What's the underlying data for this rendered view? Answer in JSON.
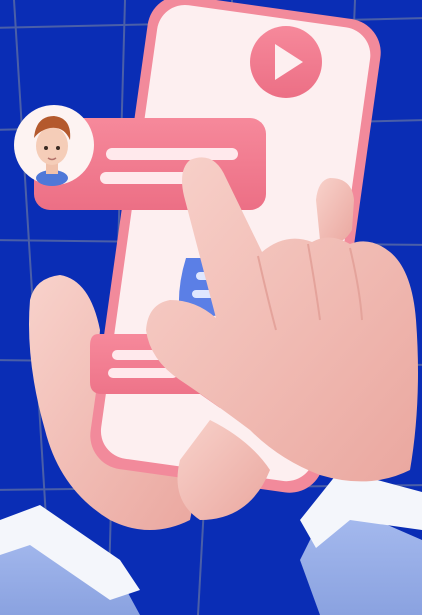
{
  "scene": {
    "description_icons": [
      "play-icon",
      "user-avatar",
      "chat-bubble-icon"
    ],
    "colors": {
      "background": "#0a2db5",
      "grid_line": "#4a5fa8",
      "phone_body": "#f28a9b",
      "phone_screen": "#fdeff0",
      "bubble_pink": "#f27a8e",
      "bubble_blue": "#5b7fe6",
      "skin": "#f4c0b8",
      "sleeve": "#9fb4ea",
      "cuff": "#f4f6fb"
    }
  }
}
